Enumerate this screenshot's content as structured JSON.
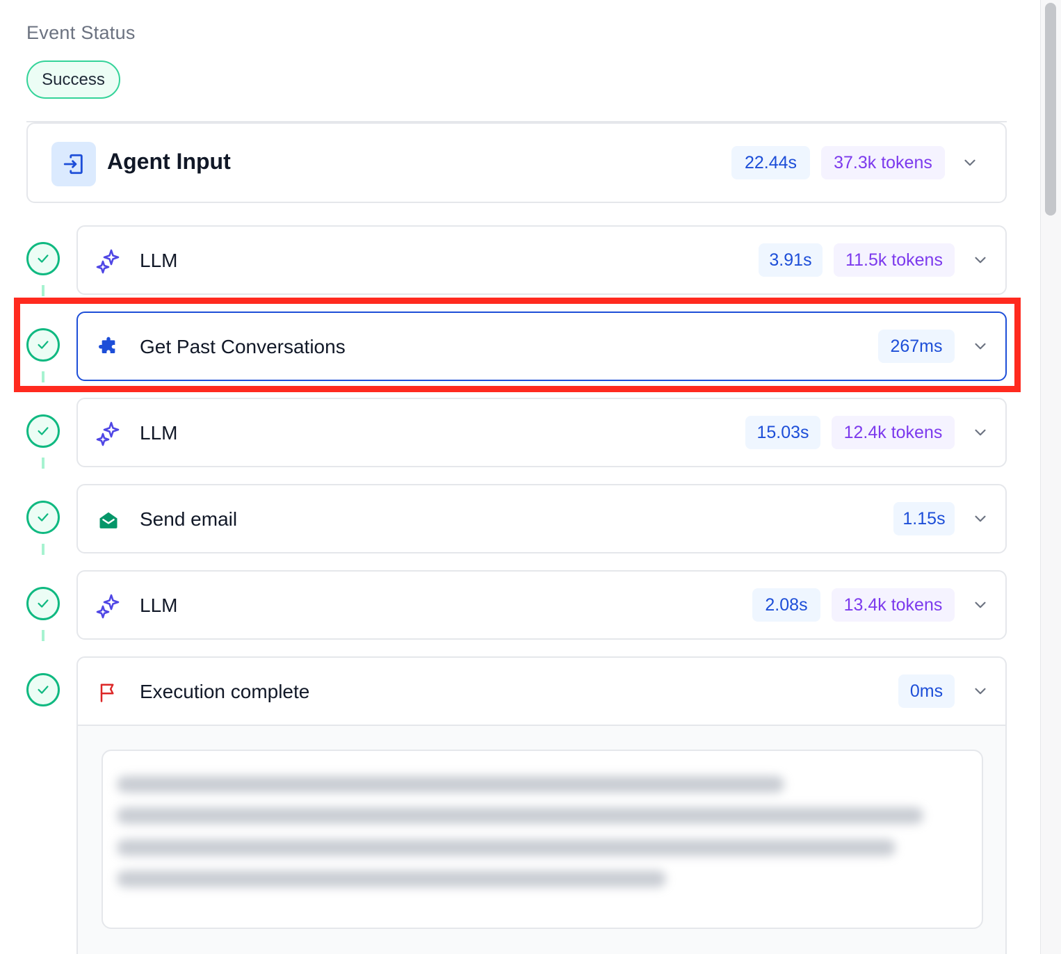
{
  "event_status": {
    "label": "Event Status",
    "badge": "Success"
  },
  "agent_input": {
    "title": "Agent Input",
    "duration": "22.44s",
    "tokens": "37.3k tokens"
  },
  "steps": [
    {
      "title": "LLM",
      "icon": "sparkles-icon",
      "duration": "3.91s",
      "tokens": "11.5k tokens"
    },
    {
      "title": "Get Past Conversations",
      "icon": "puzzle-icon",
      "duration": "267ms",
      "selected": true
    },
    {
      "title": "LLM",
      "icon": "sparkles-icon",
      "duration": "15.03s",
      "tokens": "12.4k tokens"
    },
    {
      "title": "Send email",
      "icon": "envelope-open-icon",
      "duration": "1.15s"
    },
    {
      "title": "LLM",
      "icon": "sparkles-icon",
      "duration": "2.08s",
      "tokens": "13.4k tokens"
    },
    {
      "title": "Execution complete",
      "icon": "flag-icon",
      "duration": "0ms",
      "expanded": true
    }
  ],
  "colors": {
    "success": "#10b981",
    "time_pill_text": "#1d4ed8",
    "tokens_pill_text": "#7c3aed",
    "highlight": "#ff2a1f",
    "selected_border": "#1d4ed8"
  }
}
